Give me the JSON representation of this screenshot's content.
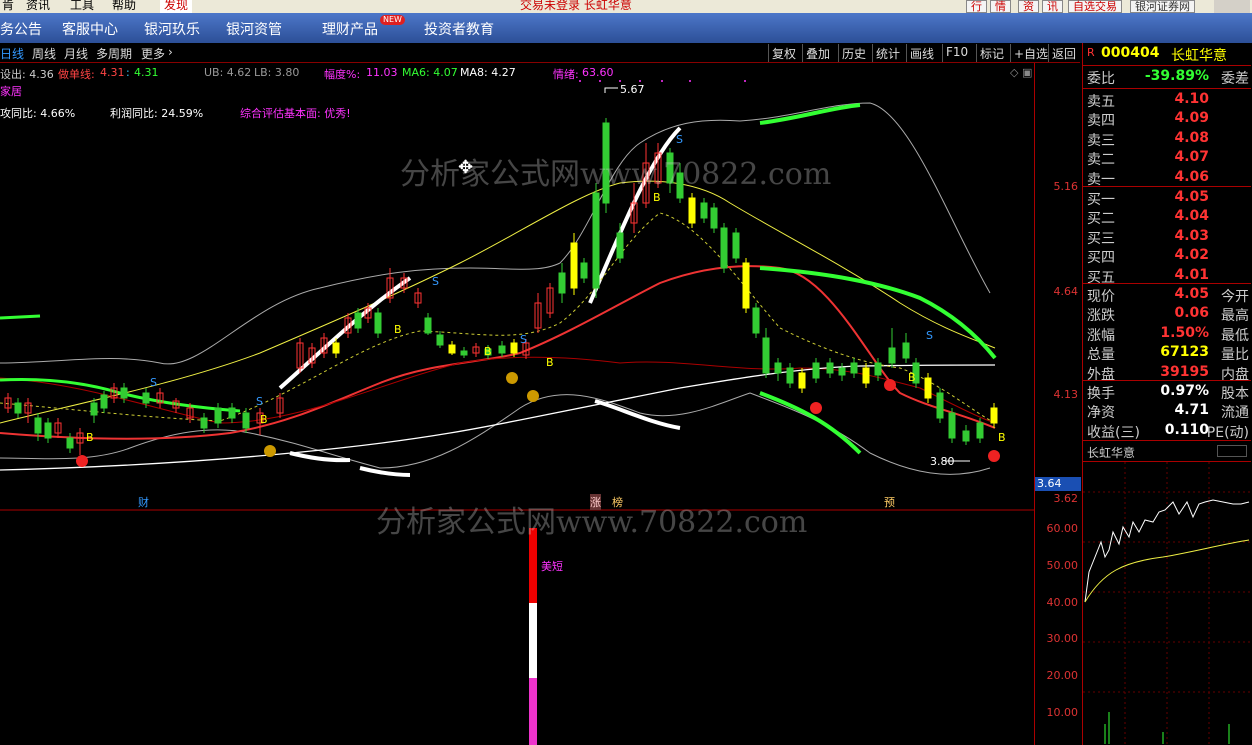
{
  "top_menu": {
    "items": [
      "肯",
      "资讯",
      "工具",
      "帮助"
    ],
    "active_tab": "发现",
    "status": "交易未登录  长虹华意",
    "buttons": [
      "行",
      "情",
      "资",
      "讯",
      "自选交易"
    ],
    "broker_label": "银河证券网"
  },
  "nav": {
    "items": [
      "务公告",
      "客服中心",
      "银河玖乐",
      "银河资管",
      "理财产品",
      "投资者教育"
    ],
    "badge": "NEW"
  },
  "period_tabs": [
    "日线",
    "周线",
    "月线",
    "多周期",
    "更多"
  ],
  "toolbar": [
    "复权",
    "叠加",
    "历史",
    "统计",
    "画线",
    "F10",
    "标记",
    "+自选",
    "返回"
  ],
  "indicators": {
    "sell": "设出: 4.36",
    "short_line_label": "做单线:",
    "short_line_v1": "4.31",
    "short_line_v2": "4.31",
    "ub": "UB: 4.62",
    "lb": "LB: 3.80",
    "range_label": "幅度%:",
    "range_value": "11.03",
    "ma6": "MA6: 4.07",
    "ma8": "MA8: 4.27",
    "mood_label": "情绪:",
    "mood_value": "63.60"
  },
  "fundamentals": {
    "sector": "家居",
    "revenue": "攻同比: 4.66%",
    "profit": "利润同比: 24.59%",
    "rating": "综合评估基本面: 优秀!"
  },
  "annotations": {
    "high": "5.67",
    "low": "3.80",
    "buy_marker": "B",
    "sell_marker": "S",
    "event_cai": "财",
    "event_zhang": "涨",
    "event_bang": "榜",
    "event_yu": "预",
    "sub_label": "美短"
  },
  "price_axis": {
    "labels": [
      "5.16",
      "4.64",
      "4.13"
    ],
    "current_box": "3.64",
    "bottom": "3.62"
  },
  "sub_axis": [
    "60.00",
    "50.00",
    "40.00",
    "30.00",
    "20.00",
    "10.00"
  ],
  "watermark": "分析家公式网www.70822.com",
  "stock": {
    "prefix": "R",
    "code": "000404",
    "name": "长虹华意",
    "weibi_label": "委比",
    "weibi_value": "-39.89%",
    "weicha_label": "委差",
    "asks": [
      {
        "label": "卖五",
        "price": "4.10"
      },
      {
        "label": "卖四",
        "price": "4.09"
      },
      {
        "label": "卖三",
        "price": "4.08"
      },
      {
        "label": "卖二",
        "price": "4.07"
      },
      {
        "label": "卖一",
        "price": "4.06"
      }
    ],
    "bids": [
      {
        "label": "买一",
        "price": "4.05"
      },
      {
        "label": "买二",
        "price": "4.04"
      },
      {
        "label": "买三",
        "price": "4.03"
      },
      {
        "label": "买四",
        "price": "4.02"
      },
      {
        "label": "买五",
        "price": "4.01"
      }
    ],
    "quote": [
      {
        "label": "现价",
        "value": "4.05",
        "label2": "今开"
      },
      {
        "label": "涨跌",
        "value": "0.06",
        "label2": "最高"
      },
      {
        "label": "涨幅",
        "value": "1.50%",
        "label2": "最低"
      },
      {
        "label": "总量",
        "value": "67123",
        "label2": "量比"
      },
      {
        "label": "外盘",
        "value": "39195",
        "label2": "内盘"
      }
    ],
    "stats": [
      {
        "label": "换手",
        "value": "0.97%",
        "label2": "股本"
      },
      {
        "label": "净资",
        "value": "4.71",
        "label2": "流通"
      },
      {
        "label": "收益(三)",
        "value": "0.110",
        "label2": "PE(动)"
      }
    ],
    "mini_title": "长虹华意"
  },
  "colors": {
    "up": "#ff3333",
    "down": "#33cccc",
    "yellow": "#ffff00",
    "green": "#33ff33",
    "magenta": "#ff33ff"
  }
}
